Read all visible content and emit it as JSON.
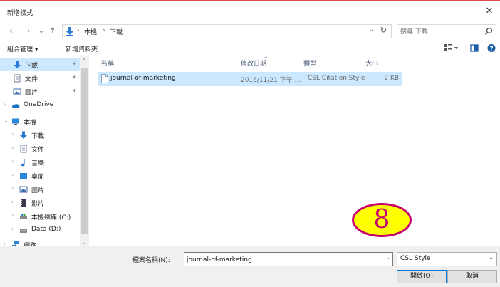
{
  "window": {
    "title": "新增樣式",
    "close_glyph": "✕"
  },
  "address": {
    "back_glyph": "←",
    "forward_glyph": "→",
    "recent_glyph": "⌄",
    "up_glyph": "↑",
    "crumbs": [
      "本機",
      "下載"
    ],
    "separator": "›",
    "dropdown_glyph": "⌄",
    "refresh_glyph": "↻",
    "search_placeholder": "搜尋 下載"
  },
  "toolbar": {
    "organize_label": "組合管理 ▾",
    "new_folder_label": "新增資料夾"
  },
  "sidebar": {
    "items": [
      {
        "label": "下載",
        "icon": "download-arrow-icon",
        "pinned": true
      },
      {
        "label": "文件",
        "icon": "document-icon",
        "pinned": true
      },
      {
        "label": "圖片",
        "icon": "pictures-icon",
        "pinned": true
      },
      {
        "label": "OneDrive",
        "icon": "onedrive-cloud-icon"
      },
      {
        "label": "本機",
        "icon": "computer-icon"
      },
      {
        "label": "下載",
        "icon": "download-arrow-icon"
      },
      {
        "label": "文件",
        "icon": "document-icon"
      },
      {
        "label": "音樂",
        "icon": "music-note-icon"
      },
      {
        "label": "桌面",
        "icon": "desktop-icon"
      },
      {
        "label": "圖片",
        "icon": "pictures-icon"
      },
      {
        "label": "影片",
        "icon": "video-icon"
      },
      {
        "label": "本機磁碟 (C:)",
        "icon": "drive-icon"
      },
      {
        "label": "Data (D:)",
        "icon": "drive-icon"
      },
      {
        "label": "網路",
        "icon": "network-icon"
      }
    ],
    "pin_glyph": "📌"
  },
  "filelist": {
    "columns": {
      "name": "名稱",
      "date": "修改日期",
      "type": "類型",
      "size": "大小"
    },
    "sort_glyph": "⌃",
    "rows": [
      {
        "name": "journal-of-marketing",
        "date": "2016/11/21 下午 …",
        "type": "CSL Citation Style",
        "size": "2 KB"
      }
    ]
  },
  "annotation": {
    "badge_number": "8"
  },
  "bottom": {
    "filename_label": "檔案名稱(N):",
    "filename_value": "journal-of-marketing",
    "filetype_value": "CSL Style",
    "open_label": "開啟(O)",
    "cancel_label": "取消"
  },
  "colors": {
    "selection": "#cce8ff",
    "accent": "#0078d7",
    "badge_fill": "#ffff00",
    "badge_stroke": "#c8006e"
  }
}
